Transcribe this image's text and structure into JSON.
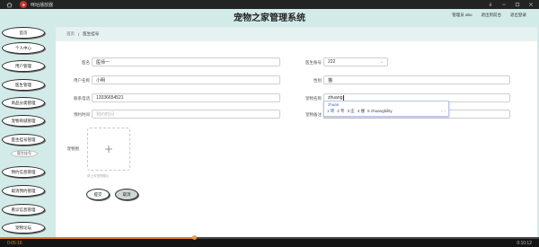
{
  "player": {
    "title": "咪咕播放器",
    "current_time": "0:05:16",
    "total_time": "0:10:12",
    "progress": 0.36
  },
  "app": {
    "title": "宠物之家管理系统",
    "header_links": [
      "管理员 abo",
      "退出到前台",
      "退出登录"
    ]
  },
  "sidebar": {
    "items": [
      {
        "label": "首页"
      },
      {
        "label": "个人中心"
      },
      {
        "label": "用户管理"
      },
      {
        "label": "医生管理"
      },
      {
        "label": "商品分类管理"
      },
      {
        "label": "宠物商城管理"
      },
      {
        "label": "医生挂号管理"
      },
      {
        "label": "预约信息管理"
      },
      {
        "label": "取消预约管理"
      },
      {
        "label": "看诊信息管理"
      },
      {
        "label": "宠物论坛"
      }
    ],
    "sub_item": "医生挂号"
  },
  "breadcrumb": {
    "home": "首页",
    "sep": "/",
    "current": "医生挂号"
  },
  "form": {
    "doctor_name_label": "医名",
    "doctor_name_value": "医师一",
    "doctor_no_label": "医生账号",
    "doctor_no_value": "222",
    "user_name_label": "用户名称",
    "user_name_value": "小明",
    "gender_label": "性别",
    "gender_value": "猫",
    "phone_label": "联系电话",
    "phone_value": "13336654521",
    "address_label": "宠物名称",
    "address_value": "zhuang",
    "appt_time_label": "预约时间",
    "appt_time_placeholder": "预约时间",
    "note_label": "宠物备注",
    "note_value": "",
    "photo_label": "宠物图",
    "photo_hint": "请上传宠物图片",
    "submit": "提交",
    "cancel": "取消"
  },
  "ime": {
    "composition": "zhuan",
    "candidates": [
      "1 转",
      "2 专",
      "3 庄",
      "4 撞",
      "5 zhuangbility"
    ]
  }
}
